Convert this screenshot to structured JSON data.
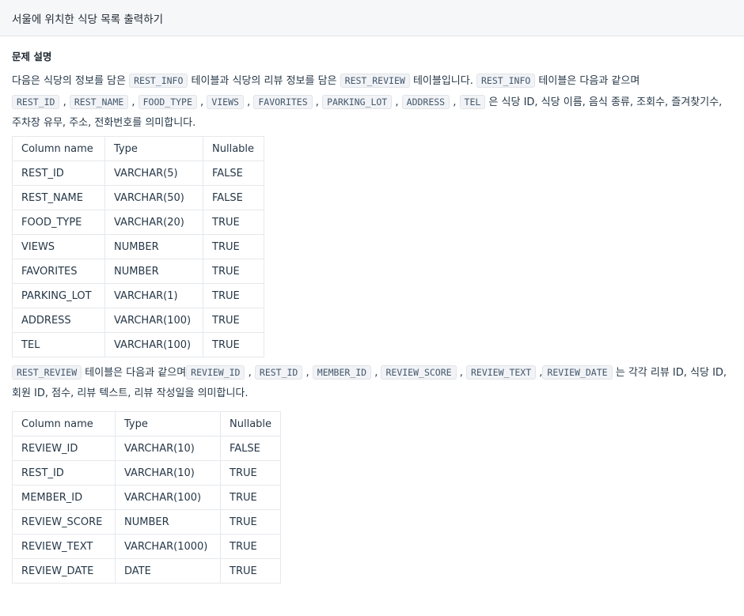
{
  "header": {
    "title": "서울에 위치한 식당 목록 출력하기"
  },
  "section": {
    "title": "문제 설명"
  },
  "para1": {
    "t1": "다음은 식당의 정보를 담은 ",
    "c1": "REST_INFO",
    "t2": " 테이블과 식당의 리뷰 정보를 담은 ",
    "c2": "REST_REVIEW",
    "t3": " 테이블입니다. ",
    "c3": "REST_INFO",
    "t4": " 테이블은 다음과 같으며",
    "fields": [
      "REST_ID",
      "REST_NAME",
      "FOOD_TYPE",
      "VIEWS",
      "FAVORITES",
      "PARKING_LOT",
      "ADDRESS",
      "TEL"
    ],
    "t5": " 은 식당 ID, 식당 이름, 음식 종류, 조회수, 즐겨찾기수, 주차장 유무, 주소, 전화번호를 의미합니다."
  },
  "table1": {
    "headers": [
      "Column name",
      "Type",
      "Nullable"
    ],
    "rows": [
      [
        "REST_ID",
        "VARCHAR(5)",
        "FALSE"
      ],
      [
        "REST_NAME",
        "VARCHAR(50)",
        "FALSE"
      ],
      [
        "FOOD_TYPE",
        "VARCHAR(20)",
        "TRUE"
      ],
      [
        "VIEWS",
        "NUMBER",
        "TRUE"
      ],
      [
        "FAVORITES",
        "NUMBER",
        "TRUE"
      ],
      [
        "PARKING_LOT",
        "VARCHAR(1)",
        "TRUE"
      ],
      [
        "ADDRESS",
        "VARCHAR(100)",
        "TRUE"
      ],
      [
        "TEL",
        "VARCHAR(100)",
        "TRUE"
      ]
    ]
  },
  "para2": {
    "c1": "REST_REVIEW",
    "t1": " 테이블은 다음과 같으며",
    "fields": [
      "REVIEW_ID",
      "REST_ID",
      "MEMBER_ID",
      "REVIEW_SCORE",
      "REVIEW_TEXT",
      "REVIEW_DATE"
    ],
    "t2": " 는 각각 리뷰 ID, 식당 ID, 회원 ID, 점수, 리뷰 텍스트, 리뷰 작성일을 의미합니다."
  },
  "table2": {
    "headers": [
      "Column name",
      "Type",
      "Nullable"
    ],
    "rows": [
      [
        "REVIEW_ID",
        "VARCHAR(10)",
        "FALSE"
      ],
      [
        "REST_ID",
        "VARCHAR(10)",
        "TRUE"
      ],
      [
        "MEMBER_ID",
        "VARCHAR(100)",
        "TRUE"
      ],
      [
        "REVIEW_SCORE",
        "NUMBER",
        "TRUE"
      ],
      [
        "REVIEW_TEXT",
        "VARCHAR(1000)",
        "TRUE"
      ],
      [
        "REVIEW_DATE",
        "DATE",
        "TRUE"
      ]
    ]
  }
}
